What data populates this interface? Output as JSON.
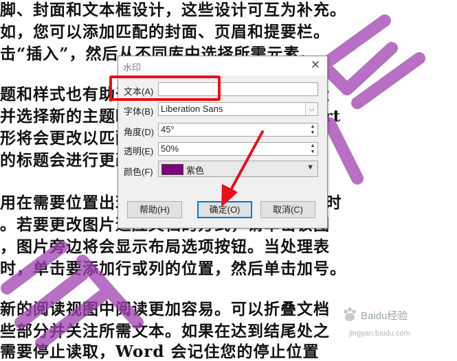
{
  "document": {
    "lines": [
      "脚、封面和文本框设计，这些设计可互为补充。",
      "如，您可以添加匹配的封面、页眉和提要栏。",
      "击“插入”，然后从不同库中选择所需元素。",
      "题和样式也有助于文档保持协调。当您单击设",
      "并选择新的主题时，图片、图表或 SmartArt",
      "形将会更改以匹配新的主题。当应用样式时，",
      "的标题会进行更改以匹配新的主题。",
      "用在需要位置出现的新按钮在 Word 中保存时",
      "。若要更改图片适应文档的方式，请单击该图",
      "，图片旁边将会显示布局选项按钮。当处理表",
      "时，单击要添加行或列的位置，然后单击加号。",
      "新的阅读视图中阅读更加容易。可以折叠文档",
      "些部分并关注所需文本。如果在达到结尾处之",
      "需要停止读取，Word 会记住您的停止位置"
    ]
  },
  "dialog": {
    "title": "水印",
    "close_glyph": "✕",
    "text_label": "文本(A)",
    "text_value": "",
    "font_label": "字体(B)",
    "font_value": "Liberation Sans",
    "angle_label": "角度(D)",
    "angle_value": "45°",
    "opacity_label": "透明(E)",
    "opacity_value": "50%",
    "color_label": "颜色(F)",
    "color_value": "紫色",
    "color_hex": "#800080",
    "help_button": "帮助(H)",
    "ok_button": "确定(O)",
    "cancel_button": "取消(C)"
  },
  "annotation": {
    "highlight_color": "#e8101a"
  },
  "watermark_logo": {
    "site_name": "Baidu经验",
    "url": "jingyan.baidu.com"
  }
}
